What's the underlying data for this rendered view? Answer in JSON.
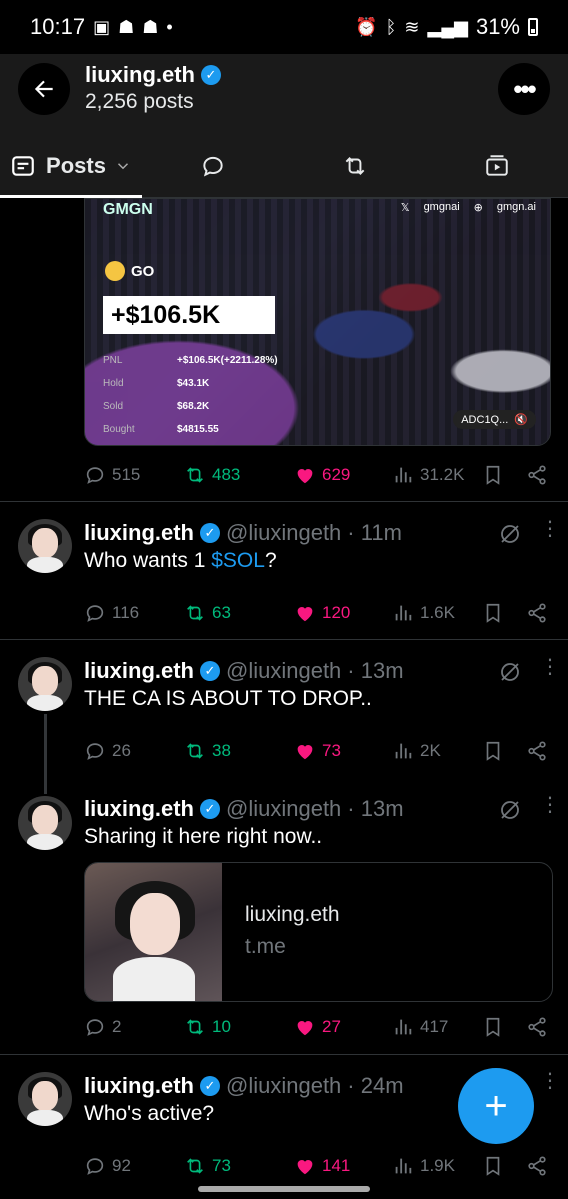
{
  "status": {
    "time": "10:17",
    "battery": "31%"
  },
  "header": {
    "name": "liuxing.eth",
    "posts_count": "2,256 posts"
  },
  "tabs": {
    "posts_label": "Posts"
  },
  "media": {
    "brand": "GMGN",
    "handle_x": "gmgnai",
    "handle_web": "gmgn.ai",
    "go_label": "GO",
    "pnl_value": "+$106.5K",
    "rows": [
      {
        "k": "PNL",
        "v": "+$106.5K(+2211.28%)"
      },
      {
        "k": "Hold",
        "v": "$43.1K"
      },
      {
        "k": "Sold",
        "v": "$68.2K"
      },
      {
        "k": "Bought",
        "v": "$4815.55"
      }
    ],
    "badge": "ADC1Q..."
  },
  "tweets": [
    {
      "stats": {
        "replies": "515",
        "reposts": "483",
        "likes": "629",
        "views": "31.2K"
      }
    },
    {
      "name": "liuxing.eth",
      "handle": "@liuxingeth",
      "time": "· 11m",
      "text_before": "Who wants 1 ",
      "link": "$SOL",
      "text_after": "?",
      "stats": {
        "replies": "116",
        "reposts": "63",
        "likes": "120",
        "views": "1.6K"
      }
    },
    {
      "name": "liuxing.eth",
      "handle": "@liuxingeth",
      "time": "· 13m",
      "text": "THE CA IS ABOUT TO DROP..",
      "stats": {
        "replies": "26",
        "reposts": "38",
        "likes": "73",
        "views": "2K"
      }
    },
    {
      "name": "liuxing.eth",
      "handle": "@liuxingeth",
      "time": "· 13m",
      "text": "Sharing it here right now..",
      "card": {
        "title": "liuxing.eth",
        "domain": "t.me"
      },
      "stats": {
        "replies": "2",
        "reposts": "10",
        "likes": "27",
        "views": "417"
      }
    },
    {
      "name": "liuxing.eth",
      "handle": "@liuxingeth",
      "time": "· 24m",
      "text": "Who's active?",
      "stats": {
        "replies": "92",
        "reposts": "73",
        "likes": "141",
        "views": "1.9K"
      }
    }
  ],
  "colors": {
    "accent": "#1d9bf0",
    "repost": "#00ba7c",
    "like": "#f91880",
    "muted": "#71767b"
  }
}
